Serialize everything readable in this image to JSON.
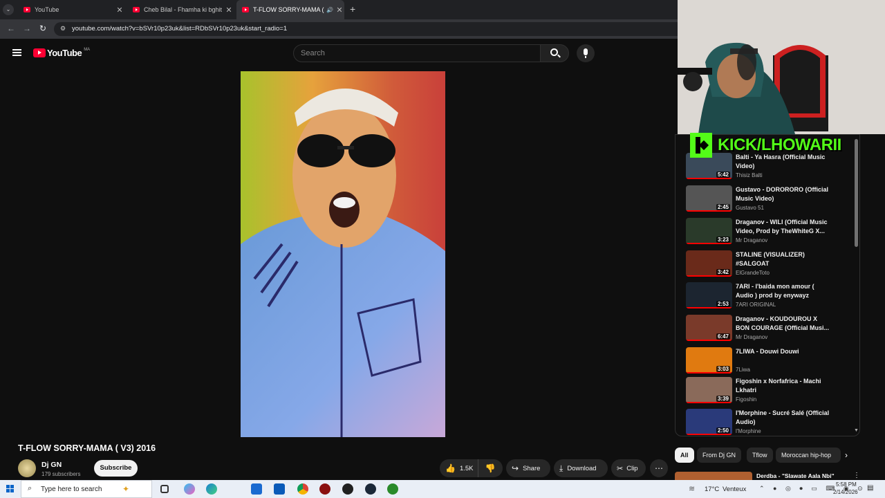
{
  "browser": {
    "tabs": [
      {
        "label": "YouTube",
        "active": false
      },
      {
        "label": "Cheb Bilal - Fhamha ki bghit - Y",
        "active": false
      },
      {
        "label": "T-FLOW SORRY-MAMA ( V3",
        "active": true
      }
    ],
    "new_tab": "+",
    "url": "youtube.com/watch?v=bSVr10p23uk&list=RDbSVr10p23uk&start_radio=1"
  },
  "youtube": {
    "logo": "YouTube",
    "region": "MA",
    "search_placeholder": "Search"
  },
  "video": {
    "title": "T-FLOW SORRY-MAMA ( V3) 2016",
    "channel": "Dj GN",
    "subscribers": "179 subscribers",
    "subscribe_label": "Subscribe",
    "likes": "1.5K",
    "share_label": "Share",
    "download_label": "Download",
    "clip_label": "Clip"
  },
  "overlay": {
    "kick_text": "KICK/LHOWARII"
  },
  "sidebar": {
    "items": [
      {
        "title": "Balti - Ya Hasra (Official Music Video)",
        "channel": "Thisiz Balti",
        "duration": "5:42",
        "thumb": "#3a4a5a"
      },
      {
        "title": "Gustavo - DORORORO (Official Music Video)",
        "channel": "Gustavo 51",
        "duration": "2:45",
        "thumb": "#555555"
      },
      {
        "title": "Draganov - WILI (Official Music Video, Prod by TheWhiteG X...",
        "channel": "Mr Draganov",
        "duration": "3:23",
        "thumb": "#2a3a2a"
      },
      {
        "title": "STALINE (VISUALIZER) #SALGOAT",
        "channel": "ElGrandeToto",
        "duration": "3:42",
        "thumb": "#6a2a1a"
      },
      {
        "title": "7ARI - l'baida mon amour ( Audio ) prod by enywayz",
        "channel": "7ARI ORIGINAL",
        "duration": "2:53",
        "thumb": "#1c2530"
      },
      {
        "title": "Draganov - KOUDOUROU X BON COURAGE (Official Musi...",
        "channel": "Mr Draganov",
        "duration": "6:47",
        "thumb": "#7a3a2a"
      },
      {
        "title": "7LIWA - Douwi Douwi",
        "channel": "7Liwa",
        "duration": "3:03",
        "thumb": "#e07a10"
      },
      {
        "title": "Figoshin x Norfafrica - Machi Lkhatri",
        "channel": "Figoshin",
        "duration": "3:39",
        "thumb": "#8a6a5a"
      },
      {
        "title": "l'Morphine - Sucré Salé (Official Audio)",
        "channel": "l'Morphine",
        "duration": "2:50",
        "thumb": "#2a3a7a"
      }
    ],
    "chips": [
      "All",
      "From Dj GN",
      "Tflow",
      "Moroccan hip-hop"
    ],
    "next_item_title": "Derdba - \"Slawate Aala Nbi\""
  },
  "taskbar": {
    "search_placeholder": "Type here to search",
    "weather_temp": "17°C",
    "weather_text": "Venteux",
    "time": "5:58 PM",
    "date": "2/14/2026"
  }
}
